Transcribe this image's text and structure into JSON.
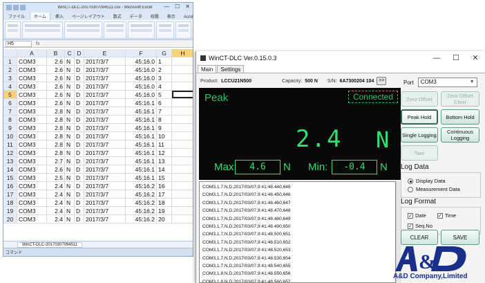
{
  "excel": {
    "title": "WinCT-DLC-20170307094511.csv - Microsoft Excel",
    "tabs": [
      "ファイル",
      "ホーム",
      "挿入",
      "ページレイアウト",
      "数式",
      "データ",
      "校閲",
      "表示",
      "Acrobat"
    ],
    "name_box": "H5",
    "columns": [
      "A",
      "B",
      "C",
      "D",
      "E",
      "F",
      "G",
      "H"
    ],
    "rows": [
      {
        "num": "1",
        "a": "COM3",
        "b": "2.6",
        "c": "N",
        "d": "D",
        "e": "2017/3/7",
        "f": "45:16.0",
        "g": "1"
      },
      {
        "num": "2",
        "a": "COM3",
        "b": "2.6",
        "c": "N",
        "d": "D",
        "e": "2017/3/7",
        "f": "45:16.0",
        "g": "2"
      },
      {
        "num": "3",
        "a": "COM3",
        "b": "2.6",
        "c": "N",
        "d": "D",
        "e": "2017/3/7",
        "f": "45:16.0",
        "g": "3"
      },
      {
        "num": "4",
        "a": "COM3",
        "b": "2.6",
        "c": "N",
        "d": "D",
        "e": "2017/3/7",
        "f": "45:16.0",
        "g": "4"
      },
      {
        "num": "5",
        "a": "COM3",
        "b": "2.6",
        "c": "N",
        "d": "D",
        "e": "2017/3/7",
        "f": "45:16.0",
        "g": "5"
      },
      {
        "num": "6",
        "a": "COM3",
        "b": "2.6",
        "c": "N",
        "d": "D",
        "e": "2017/3/7",
        "f": "45:16.1",
        "g": "6"
      },
      {
        "num": "7",
        "a": "COM3",
        "b": "2.8",
        "c": "N",
        "d": "D",
        "e": "2017/3/7",
        "f": "45:16.1",
        "g": "7"
      },
      {
        "num": "8",
        "a": "COM3",
        "b": "2.8",
        "c": "N",
        "d": "D",
        "e": "2017/3/7",
        "f": "45:16.1",
        "g": "8"
      },
      {
        "num": "9",
        "a": "COM3",
        "b": "2.8",
        "c": "N",
        "d": "D",
        "e": "2017/3/7",
        "f": "45:16.1",
        "g": "9"
      },
      {
        "num": "10",
        "a": "COM3",
        "b": "2.8",
        "c": "N",
        "d": "D",
        "e": "2017/3/7",
        "f": "45:16.1",
        "g": "10"
      },
      {
        "num": "11",
        "a": "COM3",
        "b": "2.8",
        "c": "N",
        "d": "D",
        "e": "2017/3/7",
        "f": "45:16.1",
        "g": "11"
      },
      {
        "num": "12",
        "a": "COM3",
        "b": "2.8",
        "c": "N",
        "d": "D",
        "e": "2017/3/7",
        "f": "45:16.1",
        "g": "12"
      },
      {
        "num": "13",
        "a": "COM3",
        "b": "2.7",
        "c": "N",
        "d": "D",
        "e": "2017/3/7",
        "f": "45:16.1",
        "g": "13"
      },
      {
        "num": "14",
        "a": "COM3",
        "b": "2.6",
        "c": "N",
        "d": "D",
        "e": "2017/3/7",
        "f": "45:16.1",
        "g": "14"
      },
      {
        "num": "15",
        "a": "COM3",
        "b": "2.5",
        "c": "N",
        "d": "D",
        "e": "2017/3/7",
        "f": "45:16.1",
        "g": "15"
      },
      {
        "num": "16",
        "a": "COM3",
        "b": "2.4",
        "c": "N",
        "d": "D",
        "e": "2017/3/7",
        "f": "45:16.2",
        "g": "16"
      },
      {
        "num": "17",
        "a": "COM3",
        "b": "2.4",
        "c": "N",
        "d": "D",
        "e": "2017/3/7",
        "f": "45:16.2",
        "g": "17"
      },
      {
        "num": "18",
        "a": "COM3",
        "b": "2.4",
        "c": "N",
        "d": "D",
        "e": "2017/3/7",
        "f": "45:16.2",
        "g": "18"
      },
      {
        "num": "19",
        "a": "COM3",
        "b": "2.4",
        "c": "N",
        "d": "D",
        "e": "2017/3/7",
        "f": "45:16.2",
        "g": "19"
      },
      {
        "num": "20",
        "a": "COM3",
        "b": "2.4",
        "c": "N",
        "d": "D",
        "e": "2017/3/7",
        "f": "45:16.2",
        "g": "20"
      }
    ],
    "selected_row": "5",
    "sheet_tab": "WinCT-DLC-20170307094511",
    "status": "コマンド"
  },
  "app": {
    "title": "WinCT-DLC Ver.0.15.0.3",
    "window_controls": [
      "—",
      "☐",
      "✕"
    ],
    "tabs": [
      "Main",
      "Settings"
    ],
    "product_label": "Product:",
    "product_value": "LCCU21N500",
    "capacity_label": "Capacity:",
    "capacity_value": "500 N",
    "sn_label": "S/N:",
    "sn_value": "6A7300204 104",
    "next_button": ">>",
    "mode": "Peak",
    "connection_status": "Connected",
    "reading_value": "2.4",
    "reading_unit": "N",
    "max_label": "Max:",
    "max_value": "4.6",
    "max_unit": "N",
    "min_label": "Min:",
    "min_value": "-0.4",
    "min_unit": "N",
    "port_label": "Port",
    "port_value": "COM3",
    "buttons": {
      "zero_offset": "Zero Offset",
      "zero_offset_clear": "Zero Offset Clear",
      "peak_hold": "Peak Hold",
      "bottom_hold": "Bottom Hold",
      "single_logging": "Single Logging",
      "continuous_logging": "Continuous Logging",
      "tare": "Tare",
      "clear": "CLEAR",
      "save": "SAVE"
    },
    "log_data": {
      "title": "Log Data",
      "display_data": "Display Data",
      "measurement_data": "Measurement Data",
      "selected": "display_data"
    },
    "log_format": {
      "title": "Log Format",
      "date": "Date",
      "time": "Time",
      "seq_no": "Seq.No",
      "date_checked": true,
      "time_checked": true,
      "seq_checked": true
    },
    "log_lines": [
      "COM3,1.7,N,D,2017/03/07,9:41:48.440,645",
      "COM3,1.7,N,D,2017/03/07,9:41:48.450,646",
      "COM3,1.7,N,D,2017/03/07,9:41:48.460,647",
      "COM3,1.7,N,D,2017/03/07,9:41:48.470,648",
      "COM3,1.7,N,D,2017/03/07,9:41:48.480,649",
      "COM3,1.7,N,D,2017/03/07,9:41:48.490,650",
      "COM3,1.7,N,D,2017/03/07,9:41:48.500,651",
      "COM3,1.7,N,D,2017/03/07,9:41:48.510,652",
      "COM3,1.7,N,D,2017/03/07,9:41:48.520,653",
      "COM3,1.7,N,D,2017/03/07,9:41:48.530,654",
      "COM3,1.7,N,D,2017/03/07,9:41:48.540,655",
      "COM3,1.8,N,D,2017/03/07,9:41:48.550,656",
      "COM3,1.8,N,D,2017/03/07,9:41:48.560,657"
    ]
  },
  "logo": {
    "brand": "A&D Company,Limited",
    "color": "#1a2f8a"
  },
  "colors": {
    "display_bg": "#090909",
    "display_green": "#30e070",
    "button_border": "#5a9a86",
    "selected_header": "#f8d27a"
  }
}
